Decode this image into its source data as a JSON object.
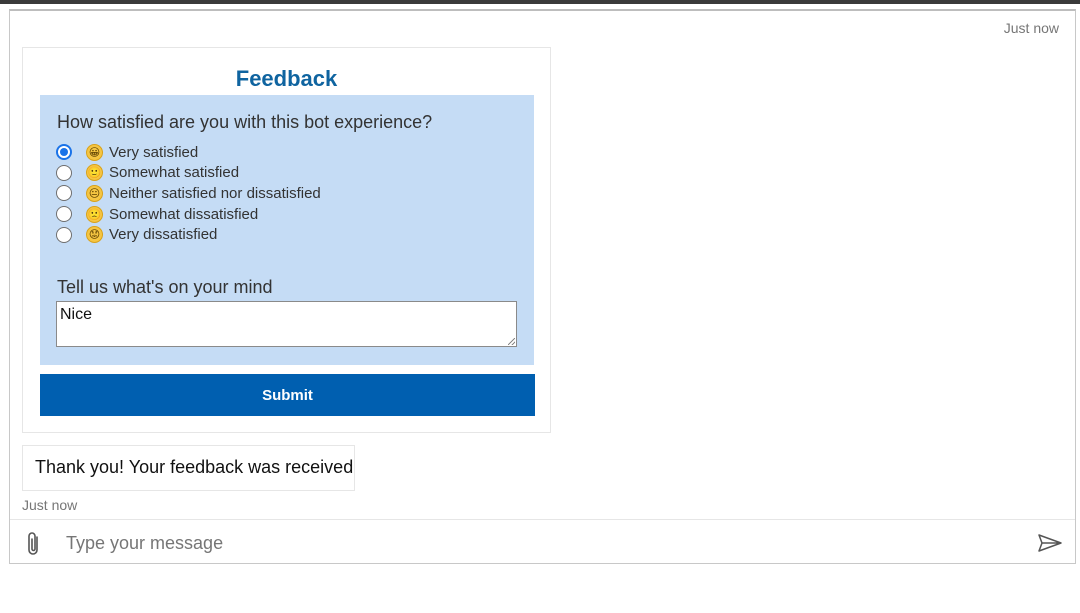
{
  "header": {
    "timestamp": "Just now"
  },
  "feedback_card": {
    "title": "Feedback",
    "question": "How satisfied are you with this bot experience?",
    "options": [
      {
        "emoji": "😀",
        "label": "Very satisfied",
        "selected": true
      },
      {
        "emoji": "🙂",
        "label": "Somewhat satisfied",
        "selected": false
      },
      {
        "emoji": "😐",
        "label": "Neither satisfied nor dissatisfied",
        "selected": false
      },
      {
        "emoji": "🙁",
        "label": "Somewhat dissatisfied",
        "selected": false
      },
      {
        "emoji": "😟",
        "label": "Very dissatisfied",
        "selected": false
      }
    ],
    "comment_label": "Tell us what's on your mind",
    "comment_value": "Nice",
    "submit_label": "Submit"
  },
  "response": {
    "message": "Thank you! Your feedback was received",
    "timestamp": "Just now"
  },
  "composer": {
    "placeholder": "Type your message",
    "attach_icon": "paperclip-icon",
    "send_icon": "send-icon"
  },
  "colors": {
    "accent": "#0f64a0",
    "button": "#005fb0",
    "panel": "#c5dcf5",
    "radio_checked": "#1a73e8"
  }
}
